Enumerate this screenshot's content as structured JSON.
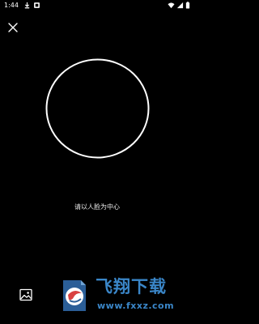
{
  "status_bar": {
    "time": "1:44",
    "icons": [
      "download-icon",
      "notification-icon",
      "wifi-icon",
      "signal-icon",
      "battery-icon"
    ]
  },
  "top_bar": {
    "close_icon": "close-icon"
  },
  "face_capture": {
    "hint": "请以人脸为中心",
    "frame_color": "#ffffff"
  },
  "bottom_bar": {
    "gallery_icon": "image-gallery-icon"
  },
  "watermark": {
    "title": "飞翔下载",
    "url": "www.fxxz.com",
    "color": "#3a86c8"
  }
}
